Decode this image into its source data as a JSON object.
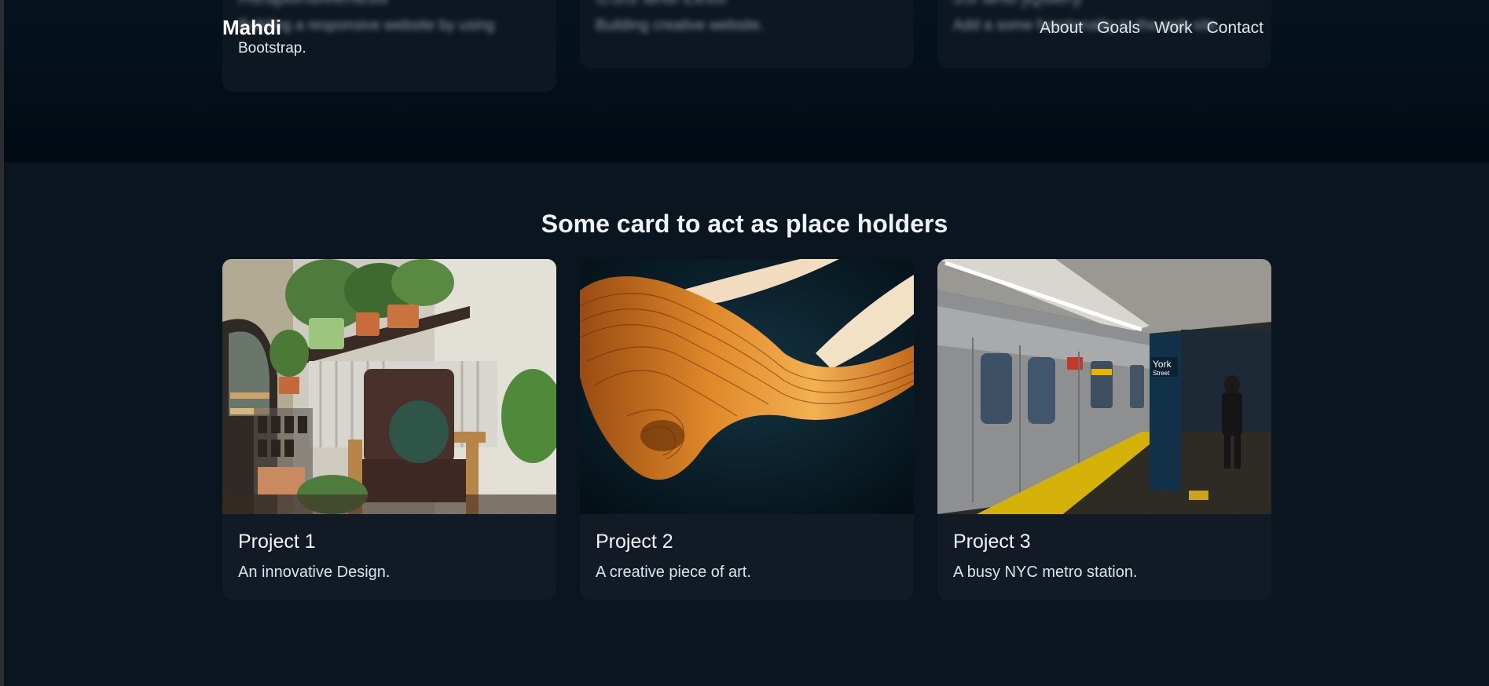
{
  "navbar": {
    "brand": "Mahdi",
    "links": [
      "About",
      "Goals",
      "Work",
      "Contact"
    ]
  },
  "goals": {
    "cards": [
      {
        "title": "Responsiveness",
        "text": "Building a responsive website by using",
        "text2": "Bootstrap."
      },
      {
        "title": "CSS and Less",
        "text": "Building creative website."
      },
      {
        "title": "JS and jQuery",
        "text": "Add a some functionality to the web site."
      }
    ]
  },
  "projects": {
    "heading": "Some card to act as place holders",
    "cards": [
      {
        "title": "Project 1",
        "description": "An innovative Design.",
        "image": "interior-plants-chair-photo"
      },
      {
        "title": "Project 2",
        "description": "A creative piece of art.",
        "image": "orange-ribbon-abstract-art"
      },
      {
        "title": "Project 3",
        "description": "A busy NYC metro station.",
        "image": "subway-train-platform-photo"
      }
    ],
    "station_sign": {
      "line1": "York",
      "line2": "Street"
    }
  },
  "colors": {
    "background": "#030d17",
    "section": "#0a1520",
    "card": "#111a25"
  }
}
